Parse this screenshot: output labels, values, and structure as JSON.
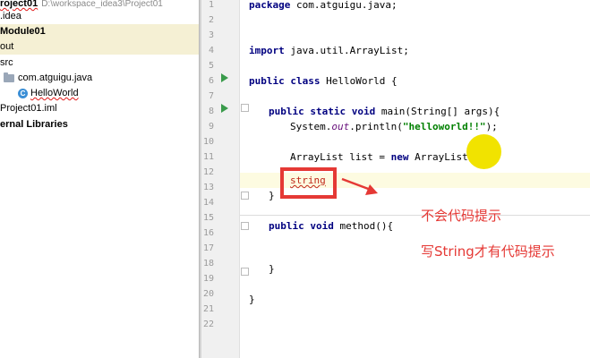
{
  "tree": {
    "items": [
      {
        "label": "roject01",
        "path": "D:\\workspace_idea3\\Project01",
        "bold": true
      },
      {
        "label": ".idea"
      },
      {
        "label": "Module01",
        "bold": true
      },
      {
        "label": "out"
      },
      {
        "label": "src"
      },
      {
        "label": "com.atguigu.java"
      },
      {
        "label": "HelloWorld"
      },
      {
        "label": "Project01.iml"
      },
      {
        "label": "ernal Libraries",
        "bold": true
      }
    ],
    "class_icon_letter": "C"
  },
  "editor": {
    "line_numbers": [
      "1",
      "2",
      "3",
      "4",
      "5",
      "6",
      "7",
      "8",
      "9",
      "10",
      "11",
      "12",
      "13",
      "14",
      "15",
      "16",
      "17",
      "18",
      "19",
      "20",
      "21",
      "22"
    ],
    "lines": {
      "l1": {
        "kw": "package",
        "rest": " com.atguigu.java;"
      },
      "l4": {
        "kw": "import",
        "rest": " java.util.ArrayList;"
      },
      "l6": {
        "kw": "public class",
        "rest": " HelloWorld {"
      },
      "l8": {
        "kw": "public static void",
        "rest": " main(String[] args){"
      },
      "l9": {
        "a": "System.",
        "field": "out",
        "b": ".println(",
        "str": "\"helloworld!!\"",
        "c": ");"
      },
      "l11": {
        "a": "ArrayList list = ",
        "kw": "new",
        "b": " ArrayList();"
      },
      "l13": {
        "err": "string"
      },
      "l14": {
        "text": "}"
      },
      "l16": {
        "kw": "public void",
        "rest": " method(){"
      },
      "l19": {
        "text": "}"
      },
      "l21": {
        "text": "}"
      }
    }
  },
  "annotations": {
    "note1": "不会代码提示",
    "note2": "写String才有代码提示",
    "color": "#e53935",
    "cursor_color": "#f1e300"
  }
}
